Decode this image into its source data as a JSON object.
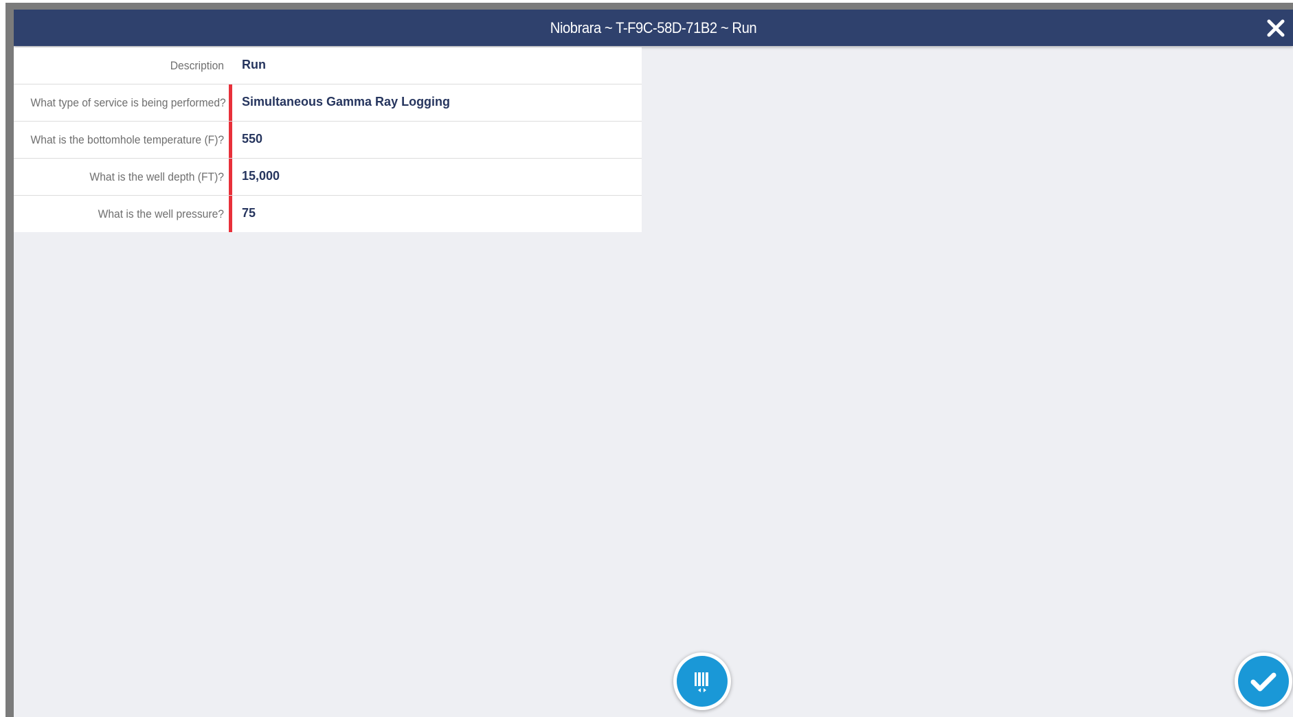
{
  "modal": {
    "title": "Niobrara ~ T-F9C-58D-71B2 ~ Run",
    "close_icon": "close-icon"
  },
  "form": {
    "rows": [
      {
        "label": "Description",
        "value": "Run",
        "required": false
      },
      {
        "label": "What type of service is being performed?",
        "value": "Simultaneous Gamma Ray Logging",
        "required": true
      },
      {
        "label": "What is the bottomhole temperature (F)?",
        "value": "550",
        "required": true
      },
      {
        "label": "What is the well depth (FT)?",
        "value": "15,000",
        "required": true
      },
      {
        "label": "What is the well pressure?",
        "value": "75",
        "required": true
      }
    ]
  },
  "actions": {
    "barcode_icon": "barcode-scan-icon",
    "confirm_icon": "checkmark-icon"
  },
  "colors": {
    "titlebar": "#2f416d",
    "required_marker": "#e8303a",
    "value_text": "#26355e",
    "fab": "#1a98d7",
    "background": "#eeeff3"
  }
}
